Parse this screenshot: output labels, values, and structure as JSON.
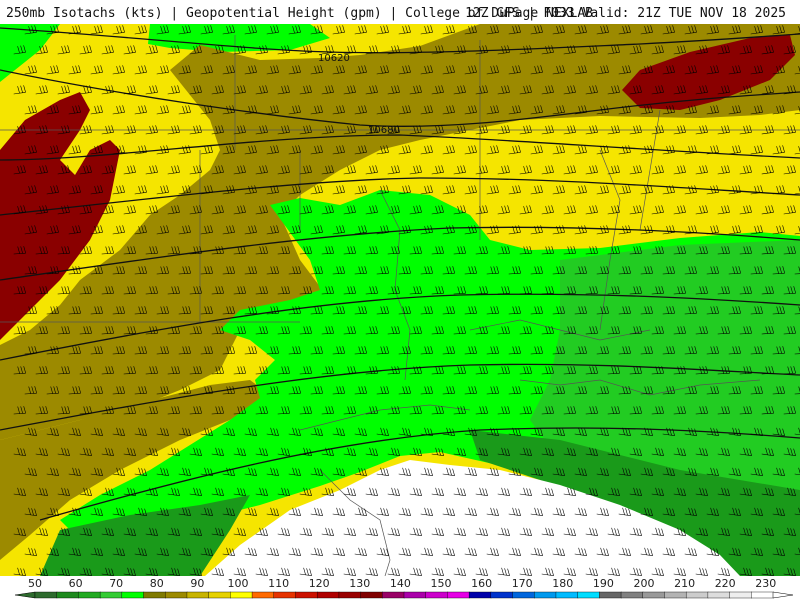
{
  "header": {
    "left": "250mb Isotachs (kts) | Geopotential Height (gpm) | College of DuPage NEXLAB",
    "right": "12Z GFS | F033 Valid: 21Z TUE NOV 18 2025"
  },
  "map": {
    "contour_labels": [
      "10620",
      "10680"
    ],
    "fills": {
      "green_light": "#00ff00",
      "green_mid": "#22cc22",
      "green_dark": "#1a9a1a",
      "olive": "#9c8a00",
      "yellow": "#f5e500",
      "maroon": "#8a0000",
      "white": "#ffffff"
    },
    "contour_color": "#111111",
    "border_color": "#555555",
    "barb_color": "#000000"
  },
  "legend": {
    "labels": [
      "50",
      "60",
      "70",
      "80",
      "90",
      "100",
      "110",
      "120",
      "130",
      "140",
      "150",
      "160",
      "170",
      "180",
      "190",
      "200",
      "210",
      "220",
      "230"
    ],
    "colors": [
      "#2e6b2e",
      "#1e8a1e",
      "#22aa22",
      "#33cc33",
      "#00ff00",
      "#7f7a00",
      "#9c8a00",
      "#c8b400",
      "#e6d200",
      "#ffff00",
      "#ff6a00",
      "#e63300",
      "#cc1100",
      "#b00000",
      "#990000",
      "#800000",
      "#990066",
      "#aa00aa",
      "#cc00cc",
      "#e600e6",
      "#0000aa",
      "#0033cc",
      "#0066dd",
      "#0099ee",
      "#00bbff",
      "#00ddff",
      "#666666",
      "#808080",
      "#999999",
      "#b3b3b3",
      "#cccccc",
      "#dddddd",
      "#eeeeee",
      "#ffffff"
    ]
  }
}
